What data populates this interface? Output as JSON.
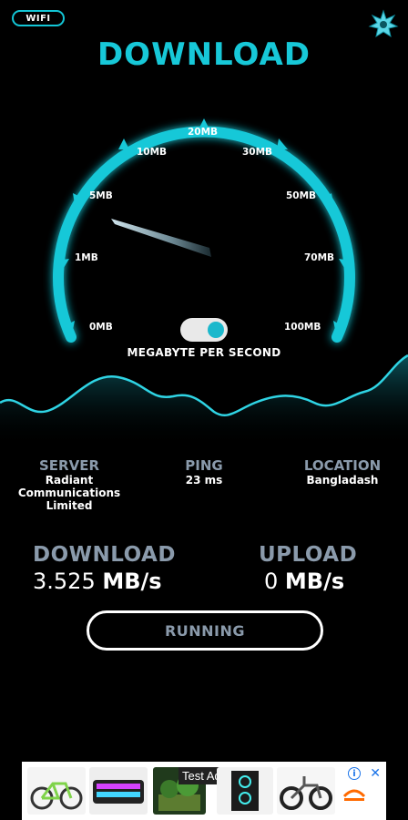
{
  "header": {
    "network_badge": "WIFI",
    "settings_icon": "gear-star-icon",
    "title": "DOWNLOAD"
  },
  "gauge": {
    "scale_labels": [
      "0MB",
      "1MB",
      "5MB",
      "10MB",
      "20MB",
      "30MB",
      "50MB",
      "70MB",
      "100MB"
    ],
    "unit_label": "MEGABYTE PER SECOND",
    "toggle_on": true,
    "accent_color": "#17c8d8"
  },
  "info": {
    "server_label": "SERVER",
    "server_line1": "Radiant",
    "server_line2": "Communications",
    "server_line3": "Limited",
    "ping_label": "PING",
    "ping_value": "23",
    "ping_unit": "ms",
    "location_label": "LOCATION",
    "location_value": "Bangladash"
  },
  "stats": {
    "download_label": "DOWNLOAD",
    "download_value": "3.525",
    "download_unit": "MB/s",
    "upload_label": "UPLOAD",
    "upload_value": "0",
    "upload_unit": "MB/s"
  },
  "action": {
    "button_label": "RUNNING"
  },
  "ad": {
    "label": "Test Ad",
    "info_icon": "info-icon",
    "close_icon": "close-icon"
  }
}
